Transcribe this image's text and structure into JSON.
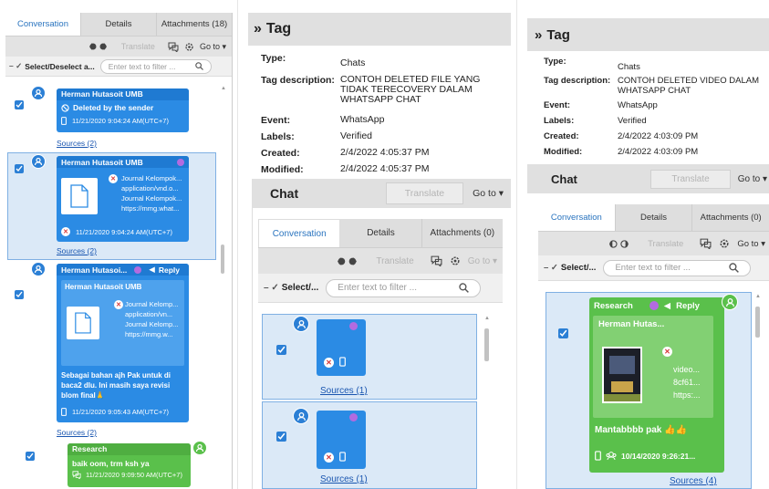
{
  "icons": {
    "filter_cb": "checkmark-icon",
    "doc": "document-icon",
    "phone": "phone-icon",
    "reply": "reply-arrow-icon",
    "chat": "chat-bubbles-icon",
    "gear": "gear-icon",
    "search": "search-icon",
    "tags": "tag-icons",
    "red_x": "deleted-x-icon"
  },
  "colors": {
    "blue_bubble": "#2b8be4",
    "green_bubble": "#5ac04b",
    "tab_active": "#2a74bf",
    "link": "#1a56b0",
    "purple_dot": "#b36be0",
    "red": "#d73a3a"
  },
  "panel1": {
    "tabs": [
      "Conversation",
      "Details",
      "Attachments (18)"
    ],
    "translate": "Translate",
    "goto": "Go to",
    "select_all": "Select/Deselect a...",
    "filter_placeholder": "Enter text to filter ...",
    "msg1": {
      "sender": "Herman Hutasoit UMB",
      "deleted": "Deleted by the sender",
      "time": "11/21/2020 9:04:24 AM(UTC+7)",
      "sources": "Sources (2)"
    },
    "msg2": {
      "sender": "Herman Hutasoit UMB",
      "att_lines": [
        "Journal Kelompok...",
        "application/vnd.o...",
        "Journal Kelompok...",
        "https://mmg.what..."
      ],
      "time": "11/21/2020 9:04:24 AM(UTC+7)",
      "sources": "Sources (2)"
    },
    "msg3": {
      "sender": "Herman Hutasoi...",
      "reply": "Reply",
      "quoted_sender": "Herman Hutasoit UMB",
      "quoted_lines": [
        "Journal Kelomp...",
        "application/vn...",
        "Journal Kelomp...",
        "https://mmg.w..."
      ],
      "text": "Sebagai bahan ajh Pak untuk di baca2 dlu. Ini masih saya revisi blom final🙏",
      "time": "11/21/2020 9:05:43 AM(UTC+7)",
      "sources": "Sources (2)"
    },
    "msg4": {
      "sender": "Research",
      "text": "baik oom, trm ksh ya",
      "time": "11/21/2020 9:09:50 AM(UTC+7)"
    }
  },
  "panel2": {
    "title": "Tag",
    "fields": [
      {
        "k": "Type:",
        "v": "Chats"
      },
      {
        "k": "Tag description:",
        "v": "CONTOH DELETED FILE YANG TIDAK TERECOVERY DALAM WHATSAPP CHAT"
      },
      {
        "k": "Event:",
        "v": "WhatsApp"
      },
      {
        "k": "Labels:",
        "v": "Verified"
      },
      {
        "k": "Created:",
        "v": "2/4/2022 4:05:37 PM"
      },
      {
        "k": "Modified:",
        "v": "2/4/2022 4:05:37 PM"
      }
    ],
    "chat_title": "Chat",
    "translate": "Translate",
    "goto": "Go to",
    "tabs": [
      "Conversation",
      "Details",
      "Attachments (0)"
    ],
    "select_all": "Select/...",
    "filter_placeholder": "Enter text to filter ...",
    "msg1": {
      "sources": "Sources (1)"
    },
    "msg2": {
      "sources": "Sources (1)"
    }
  },
  "panel3": {
    "title": "Tag",
    "fields": [
      {
        "k": "Type:",
        "v": "Chats"
      },
      {
        "k": "Tag description:",
        "v": "CONTOH DELETED VIDEO DALAM WHATSAPP CHAT"
      },
      {
        "k": "Event:",
        "v": "WhatsApp"
      },
      {
        "k": "Labels:",
        "v": "Verified"
      },
      {
        "k": "Created:",
        "v": "2/4/2022 4:03:09 PM"
      },
      {
        "k": "Modified:",
        "v": "2/4/2022 4:03:09 PM"
      }
    ],
    "chat_title": "Chat",
    "translate": "Translate",
    "goto": "Go to",
    "tabs": [
      "Conversation",
      "Details",
      "Attachments (0)"
    ],
    "select_all": "Select/...",
    "filter_placeholder": "Enter text to filter ...",
    "msg": {
      "sender": "Research",
      "reply": "Reply",
      "quoted_sender": "Herman Hutas...",
      "video_lines": [
        "video...",
        "8cf61...",
        "https:..."
      ],
      "text": "Mantabbbb pak 👍👍",
      "time": "10/14/2020 9:26:21...",
      "sources": "Sources (4)"
    }
  }
}
